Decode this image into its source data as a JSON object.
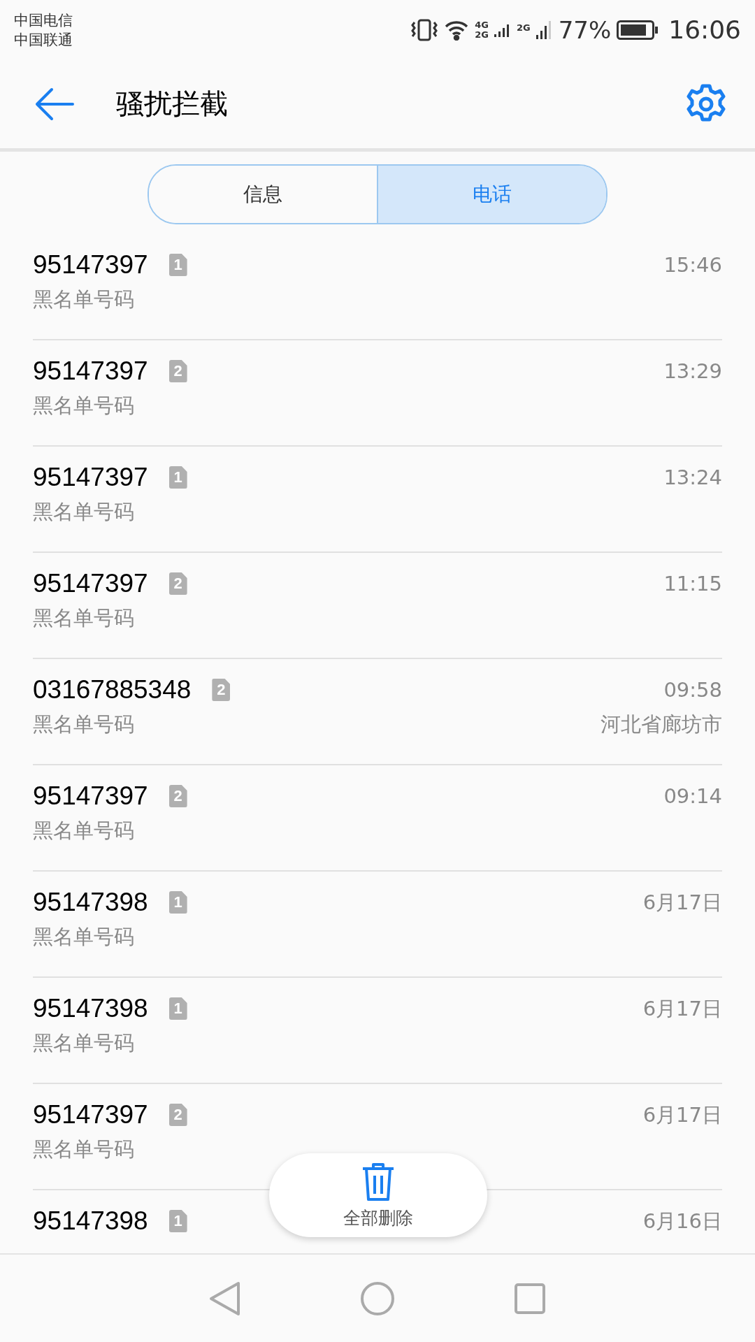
{
  "status_bar": {
    "carriers": [
      "中国电信",
      "中国联通"
    ],
    "network_1": [
      "4G",
      "2G"
    ],
    "network_2": "2G",
    "battery": "77%",
    "time": "16:06"
  },
  "header": {
    "title": "骚扰拦截"
  },
  "tabs": [
    {
      "label": "信息",
      "selected": false
    },
    {
      "label": "电话",
      "selected": true
    }
  ],
  "calls": [
    {
      "number": "95147397",
      "sim": "1",
      "label": "黑名单号码",
      "time": "15:46"
    },
    {
      "number": "95147397",
      "sim": "2",
      "label": "黑名单号码",
      "time": "13:29"
    },
    {
      "number": "95147397",
      "sim": "1",
      "label": "黑名单号码",
      "time": "13:24"
    },
    {
      "number": "95147397",
      "sim": "2",
      "label": "黑名单号码",
      "time": "11:15"
    },
    {
      "number": "03167885348",
      "sim": "2",
      "label": "黑名单号码",
      "time": "09:58",
      "location": "河北省廊坊市"
    },
    {
      "number": "95147397",
      "sim": "2",
      "label": "黑名单号码",
      "time": "09:14"
    },
    {
      "number": "95147398",
      "sim": "1",
      "label": "黑名单号码",
      "time": "6月17日"
    },
    {
      "number": "95147398",
      "sim": "1",
      "label": "黑名单号码",
      "time": "6月17日"
    },
    {
      "number": "95147397",
      "sim": "2",
      "label": "黑名单号码",
      "time": "6月17日"
    },
    {
      "number": "95147398",
      "sim": "1",
      "time": "6月16日"
    }
  ],
  "delete_all": {
    "label": "全部删除"
  }
}
